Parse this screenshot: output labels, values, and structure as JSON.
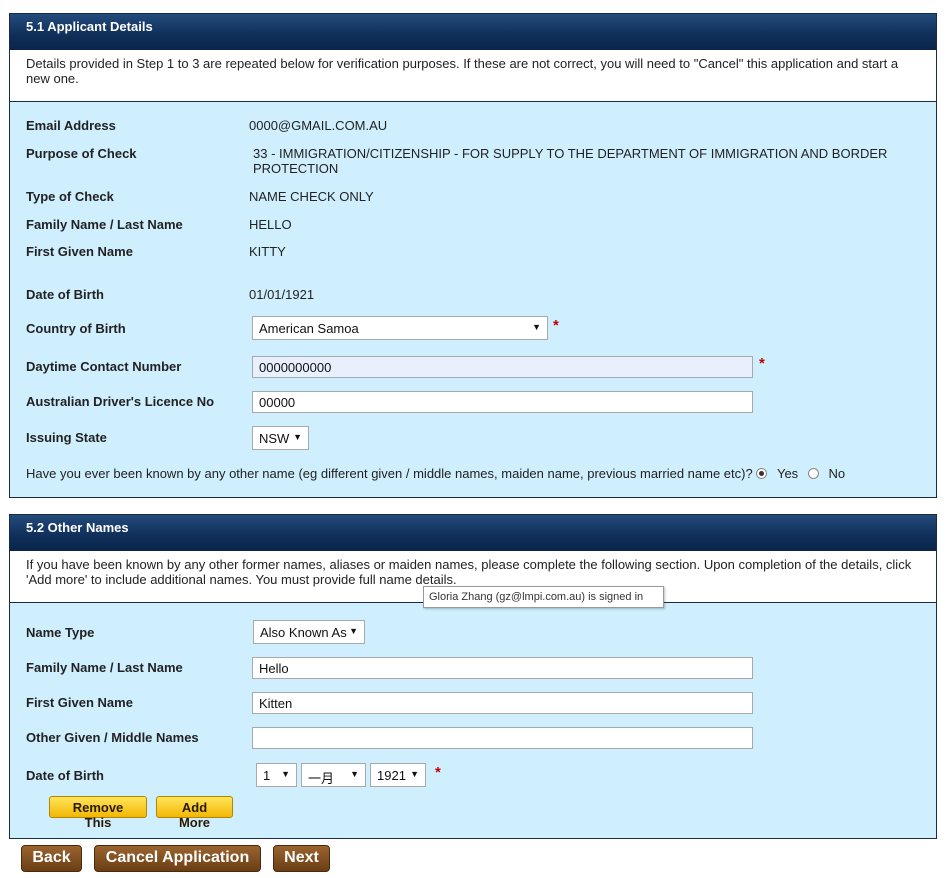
{
  "applicant": {
    "header": "5.1 Applicant Details",
    "intro": "Details provided in Step 1 to 3 are repeated below for verification purposes. If these are not correct, you will need to \"Cancel\" this application and start a new one.",
    "email_label": "Email Address",
    "email_value": "0000@GMAIL.COM.AU",
    "purpose_label": "Purpose of Check",
    "purpose_value_line1": "33 - IMMIGRATION/CITIZENSHIP - FOR SUPPLY TO THE DEPARTMENT OF IMMIGRATION AND BORDER",
    "purpose_value_line2": "PROTECTION",
    "type_label": "Type of Check",
    "type_value": "NAME CHECK ONLY",
    "family_label": "Family Name / Last Name",
    "family_value": "HELLO",
    "given_label": "First Given Name",
    "given_value": "KITTY",
    "dob_label": "Date of Birth",
    "dob_value": "01/01/1921",
    "country_label": "Country of Birth",
    "country_value": "American Samoa",
    "phone_label": "Daytime Contact Number",
    "phone_value": "0000000000",
    "licence_label": "Australian Driver's Licence No",
    "licence_value": "00000",
    "state_label": "Issuing State",
    "state_value": "NSW",
    "other_name_question": "Have you ever been known by any other name (eg different given / middle names, maiden name, previous married name etc)?",
    "yes_label": "Yes",
    "no_label": "No",
    "required_mark": "*"
  },
  "other_names": {
    "header": "5.2 Other Names",
    "intro_line1": "If you have been known by any other former names, aliases or maiden names, please complete the following section. Upon completion of the details, click",
    "intro_line2": "'Add more' to include additional names. You must provide full name details.",
    "name_type_label": "Name Type",
    "name_type_value": "Also Known As",
    "family_label": "Family Name / Last Name",
    "family_value": "Hello",
    "given_label": "First Given Name",
    "given_value": "Kitten",
    "other_given_label": "Other Given / Middle Names",
    "other_given_value": "",
    "dob_label": "Date of Birth",
    "dob_day": "1",
    "dob_month": "一月",
    "dob_year": "1921",
    "remove_label": "Remove This",
    "add_label": "Add More"
  },
  "tooltip": "Gloria Zhang (gz@lmpi.com.au) is signed in",
  "nav": {
    "back": "Back",
    "cancel": "Cancel Application",
    "next": "Next"
  }
}
